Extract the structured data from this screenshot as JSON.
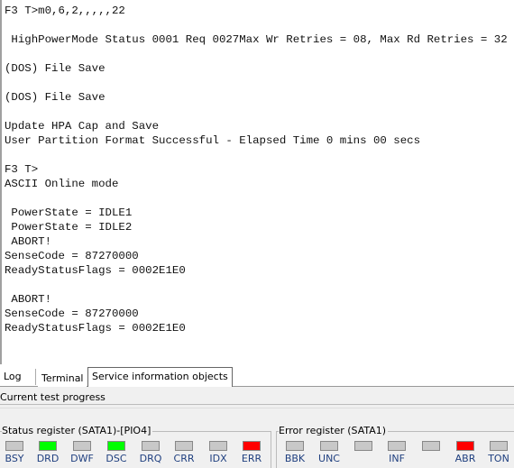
{
  "terminal": {
    "lines": [
      "F3 T>m0,6,2,,,,,22",
      "",
      " HighPowerMode Status 0001 Req 0027Max Wr Retries = 08, Max Rd Retries = 32",
      "",
      "(DOS) File Save",
      "",
      "(DOS) File Save",
      "",
      "Update HPA Cap and Save",
      "User Partition Format Successful - Elapsed Time 0 mins 00 secs",
      "",
      "F3 T>",
      "ASCII Online mode",
      "",
      " PowerState = IDLE1",
      " PowerState = IDLE2",
      " ABORT!",
      "SenseCode = 87270000",
      "ReadyStatusFlags = 0002E1E0",
      "",
      " ABORT!",
      "SenseCode = 87270000",
      "ReadyStatusFlags = 0002E1E0"
    ]
  },
  "tabs": [
    "Log",
    "Terminal",
    "Service information objects"
  ],
  "active_tab": "Terminal",
  "progress": {
    "label": "Current test progress",
    "value": 0
  },
  "status_register": {
    "title": "Status register (SATA1)-[PIO4]",
    "flags": [
      {
        "label": "BSY",
        "color": "#c8c8c8"
      },
      {
        "label": "DRD",
        "color": "#00ff00"
      },
      {
        "label": "DWF",
        "color": "#c8c8c8"
      },
      {
        "label": "DSC",
        "color": "#00ff00"
      },
      {
        "label": "DRQ",
        "color": "#c8c8c8"
      },
      {
        "label": "CRR",
        "color": "#c8c8c8"
      },
      {
        "label": "IDX",
        "color": "#c8c8c8"
      },
      {
        "label": "ERR",
        "color": "#ff0000"
      }
    ]
  },
  "error_register": {
    "title": "Error register (SATA1)",
    "flags": [
      {
        "label": "BBK",
        "color": "#c8c8c8"
      },
      {
        "label": "UNC",
        "color": "#c8c8c8"
      },
      {
        "label": "",
        "color": "#c8c8c8"
      },
      {
        "label": "INF",
        "color": "#c8c8c8"
      },
      {
        "label": "",
        "color": "#c8c8c8"
      },
      {
        "label": "ABR",
        "color": "#ff0000"
      },
      {
        "label": "TON",
        "color": "#c8c8c8"
      }
    ]
  }
}
